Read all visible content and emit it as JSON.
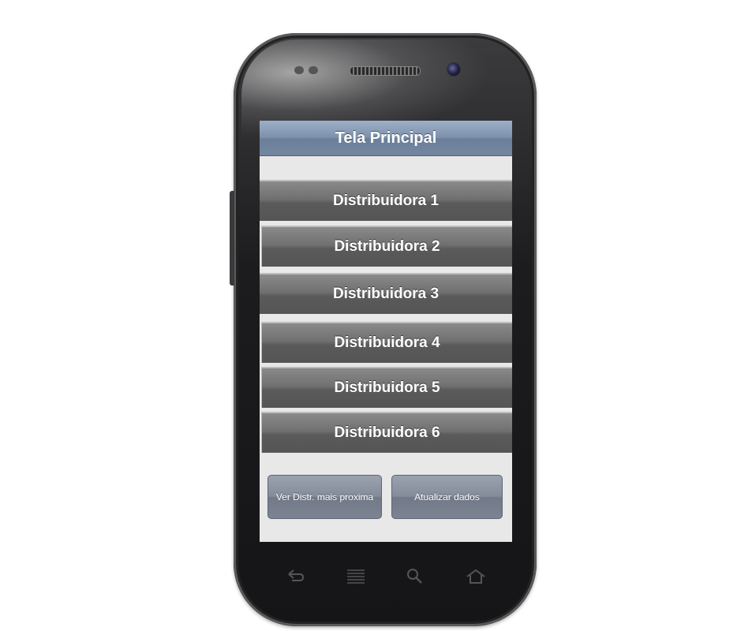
{
  "header": {
    "title": "Tela Principal"
  },
  "distributors": [
    {
      "label": "Distribuidora 1"
    },
    {
      "label": "Distribuidora 2"
    },
    {
      "label": "Distribuidora 3"
    },
    {
      "label": "Distribuidora 4"
    },
    {
      "label": "Distribuidora 5"
    },
    {
      "label": "Distribuidora 6"
    }
  ],
  "actions": {
    "nearest_label": "Ver Distr. mais proxima",
    "update_label": "Atualizar dados"
  },
  "nav_icons": [
    "back-icon",
    "menu-icon",
    "search-icon",
    "home-icon"
  ],
  "colors": {
    "header": "#7d91ac",
    "list_button": "#6a6a6a",
    "action_button": "#858d9b",
    "screen_background": "#e8e8e8"
  }
}
